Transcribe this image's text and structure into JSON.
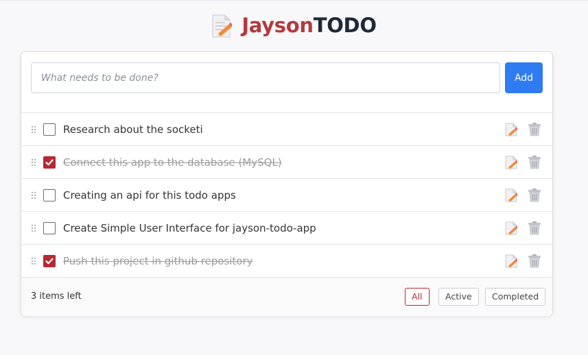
{
  "header": {
    "logo_icon": "memo-pencil-icon",
    "title_part1": "Jayson",
    "title_part2": "TODO",
    "colors": {
      "part1": "#b33a3f",
      "part2": "#1f2937"
    }
  },
  "add_form": {
    "input_value": "",
    "placeholder": "What needs to be done?",
    "add_label": "Add",
    "add_color": "#2f7bf1"
  },
  "todos": [
    {
      "text": "Research about the socketi",
      "completed": false
    },
    {
      "text": "Connect this app to the database (MySQL)",
      "completed": true
    },
    {
      "text": "Creating an api for this todo apps",
      "completed": false
    },
    {
      "text": "Create Simple User Interface for jayson-todo-app",
      "completed": false
    },
    {
      "text": "Push this project in github repository",
      "completed": true
    }
  ],
  "row_icons": {
    "drag": "drag-handle-icon",
    "edit": "edit-pencil-icon",
    "delete": "trash-icon"
  },
  "footer": {
    "items_left": "3 items left",
    "filters": [
      {
        "label": "All",
        "active": true
      },
      {
        "label": "Active",
        "active": false
      },
      {
        "label": "Completed",
        "active": false
      }
    ]
  },
  "accent_color": "#b52a33"
}
